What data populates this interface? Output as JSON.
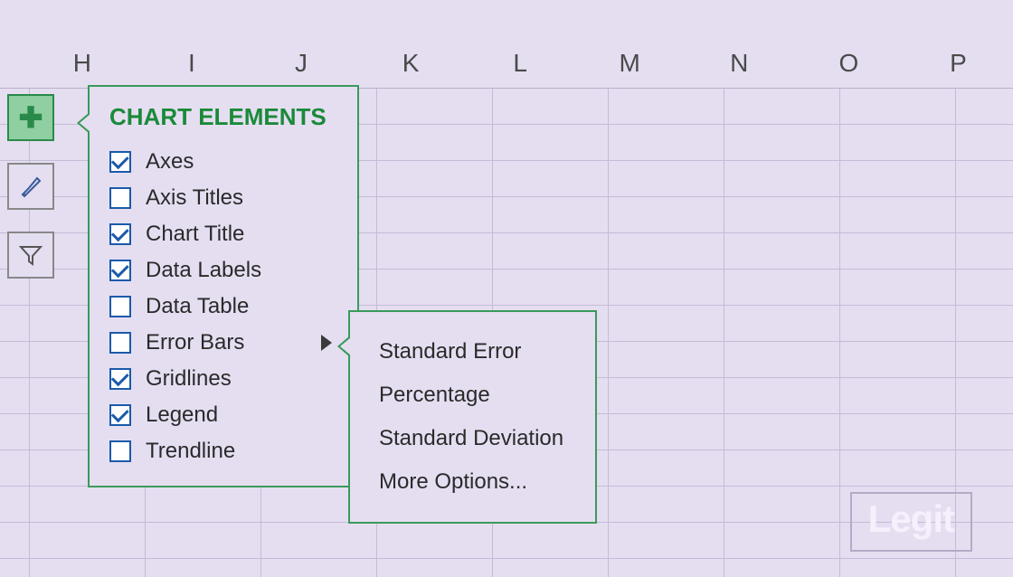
{
  "columns": [
    "H",
    "I",
    "J",
    "K",
    "L",
    "M",
    "N",
    "O",
    "P"
  ],
  "toolbar": {
    "chart_elements": {
      "label": "Chart Elements",
      "active": true
    },
    "chart_styles": {
      "label": "Chart Styles"
    },
    "chart_filters": {
      "label": "Chart Filters"
    }
  },
  "popover": {
    "title": "CHART ELEMENTS",
    "items": [
      {
        "label": "Axes",
        "checked": true
      },
      {
        "label": "Axis Titles",
        "checked": false
      },
      {
        "label": "Chart Title",
        "checked": true
      },
      {
        "label": "Data Labels",
        "checked": true
      },
      {
        "label": "Data Table",
        "checked": false
      },
      {
        "label": "Error Bars",
        "checked": false,
        "has_flyout": true
      },
      {
        "label": "Gridlines",
        "checked": true
      },
      {
        "label": "Legend",
        "checked": true
      },
      {
        "label": "Trendline",
        "checked": false
      }
    ]
  },
  "submenu": {
    "items": [
      "Standard Error",
      "Percentage",
      "Standard Deviation",
      "More Options..."
    ]
  },
  "watermark": "Legit"
}
